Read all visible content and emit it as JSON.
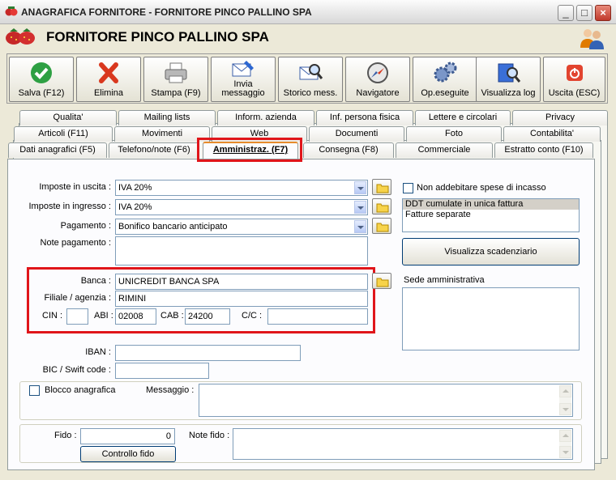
{
  "window": {
    "title": "ANAGRAFICA FORNITORE - FORNITORE PINCO PALLINO SPA",
    "minimize_glyph": "_",
    "maximize_glyph": "□",
    "close_glyph": "×"
  },
  "header": {
    "title": "FORNITORE PINCO PALLINO SPA"
  },
  "toolbar": {
    "buttons": [
      {
        "label": "Salva (F12)",
        "icon": "check-icon"
      },
      {
        "label": "Elimina",
        "icon": "x-icon"
      },
      {
        "label": "Stampa (F9)",
        "icon": "printer-icon"
      },
      {
        "label": "Invia",
        "label2": "messaggio",
        "icon": "mail-pen-icon"
      },
      {
        "label": "Storico mess.",
        "icon": "mail-search-icon"
      },
      {
        "label": "Navigatore",
        "icon": "compass-icon"
      },
      {
        "label": "Op.eseguite",
        "icon": "gears-icon"
      },
      {
        "label": "Visualizza log",
        "icon": "book-search-icon"
      },
      {
        "label": "Uscita (ESC)",
        "icon": "power-icon"
      }
    ]
  },
  "tabs": {
    "row1": [
      "Qualita'",
      "Mailing lists",
      "Inform. azienda",
      "Inf. persona fisica",
      "Lettere e circolari",
      "Privacy"
    ],
    "row2": [
      "Articoli (F11)",
      "Movimenti",
      "Web",
      "Documenti",
      "Foto",
      "Contabilita'"
    ],
    "row3": [
      "Dati anagrafici (F5)",
      "Telefono/note (F6)",
      "Amministraz. (F7)",
      "Consegna (F8)",
      "Commerciale",
      "Estratto conto (F10)"
    ],
    "active": "Amministraz. (F7)"
  },
  "form": {
    "imposte_uscita": {
      "label": "Imposte in uscita :",
      "value": "IVA 20%"
    },
    "imposte_ingresso": {
      "label": "Imposte in ingresso :",
      "value": "IVA 20%"
    },
    "pagamento": {
      "label": "Pagamento :",
      "value": "Bonifico bancario anticipato"
    },
    "note_pagamento": {
      "label": "Note pagamento :",
      "value": ""
    },
    "banca": {
      "label": "Banca :",
      "value": "UNICREDIT BANCA SPA"
    },
    "filiale": {
      "label": "Filiale / agenzia :",
      "value": "RIMINI"
    },
    "cin": {
      "label": "CIN :",
      "value": ""
    },
    "abi": {
      "label": "ABI :",
      "value": "02008"
    },
    "cab": {
      "label": "CAB :",
      "value": "24200"
    },
    "cc": {
      "label": "C/C :",
      "value": ""
    },
    "iban": {
      "label": "IBAN :",
      "value": ""
    },
    "bic": {
      "label": "BIC / Swift code :",
      "value": ""
    },
    "non_addebitare": {
      "label": "Non addebitare spese di incasso",
      "checked": false
    },
    "ddt_options": [
      "DDT cumulate in unica fattura",
      "Fatture separate"
    ],
    "ddt_selected": "DDT cumulate in unica fattura",
    "visualizza_scadenziario": "Visualizza scadenziario",
    "sede_amministrativa": {
      "label": "Sede amministrativa",
      "value": ""
    },
    "blocco_anagrafica": {
      "label": "Blocco anagrafica",
      "checked": false
    },
    "messaggio": {
      "label": "Messaggio :",
      "value": ""
    },
    "fido": {
      "label": "Fido :",
      "value": "0"
    },
    "note_fido": {
      "label": "Note fido :",
      "value": ""
    },
    "controllo_fido": "Controllo fido"
  },
  "colors": {
    "highlight_box": "#e0151a",
    "tab_active_top": "#e68b2c",
    "input_border": "#7f9db9"
  }
}
